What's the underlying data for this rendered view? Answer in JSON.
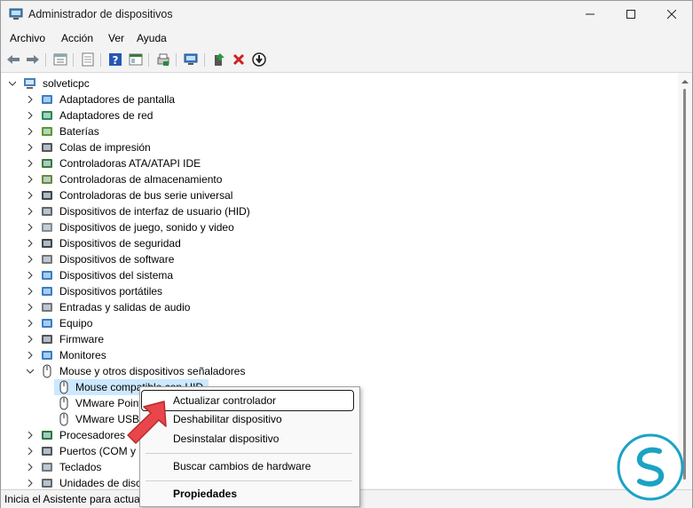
{
  "window": {
    "title": "Administrador de dispositivos"
  },
  "menu": [
    "Archivo",
    "Acción",
    "Ver",
    "Ayuda"
  ],
  "tree": {
    "root": "solveticpc",
    "categories": [
      "Adaptadores de pantalla",
      "Adaptadores de red",
      "Baterías",
      "Colas de impresión",
      "Controladoras ATA/ATAPI IDE",
      "Controladoras de almacenamiento",
      "Controladoras de bus serie universal",
      "Dispositivos de interfaz de usuario (HID)",
      "Dispositivos de juego, sonido y video",
      "Dispositivos de seguridad",
      "Dispositivos de software",
      "Dispositivos del sistema",
      "Dispositivos portátiles",
      "Entradas y salidas de audio",
      "Equipo",
      "Firmware",
      "Monitores",
      "Mouse y otros dispositivos señaladores"
    ],
    "mouse_children": [
      "Mouse compatible con HID",
      "VMware Point",
      "VMware USB"
    ],
    "after": [
      "Procesadores",
      "Puertos (COM y L",
      "Teclados",
      "Unidades de disco"
    ]
  },
  "status": {
    "text": "Inicia el Asistente para actual"
  },
  "context_menu": {
    "items": [
      {
        "label": "Actualizar controlador",
        "highlighted": true
      },
      {
        "label": "Deshabilitar dispositivo"
      },
      {
        "label": "Desinstalar dispositivo"
      },
      {
        "label": "Buscar cambios de hardware"
      },
      {
        "label": "Propiedades",
        "bold": true
      }
    ]
  },
  "colors": {
    "selection": "#cce8ff",
    "arrow": "#e8464a",
    "brand": "#1aa3c4"
  }
}
